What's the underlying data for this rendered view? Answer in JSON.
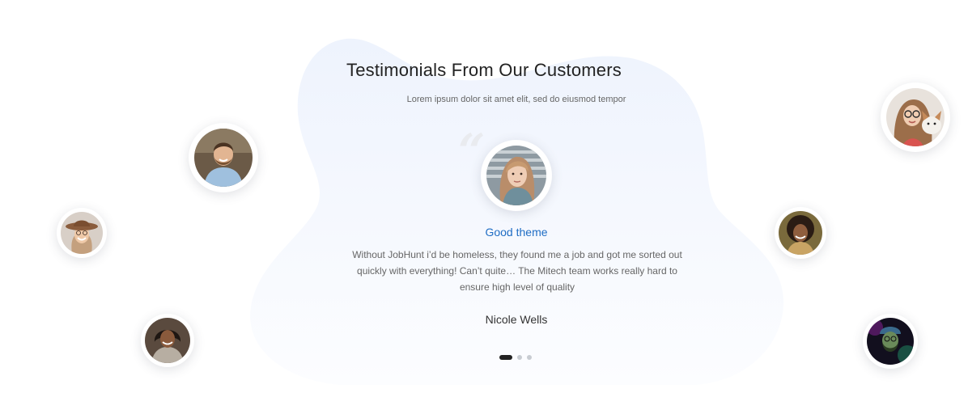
{
  "section": {
    "title": "Testimonials From Our Customers",
    "subtitle": "Lorem ipsum dolor sit amet elit, sed do eiusmod tempor"
  },
  "testimonial": {
    "quote_mark": "“",
    "heading": "Good theme",
    "text": "Without JobHunt i’d be homeless, they found me a job and got me sorted out quickly with everything! Can’t quite… The Mitech team works really hard to ensure high level of quality",
    "author": "Nicole Wells"
  },
  "carousel": {
    "total_slides": 3,
    "active_index": 0
  },
  "colors": {
    "accent": "#1f6dc4",
    "title": "#222222",
    "body_text": "#666666",
    "blob": "#f1f5fd",
    "dot_active": "#222222",
    "dot_inactive": "#c8ccd2"
  }
}
